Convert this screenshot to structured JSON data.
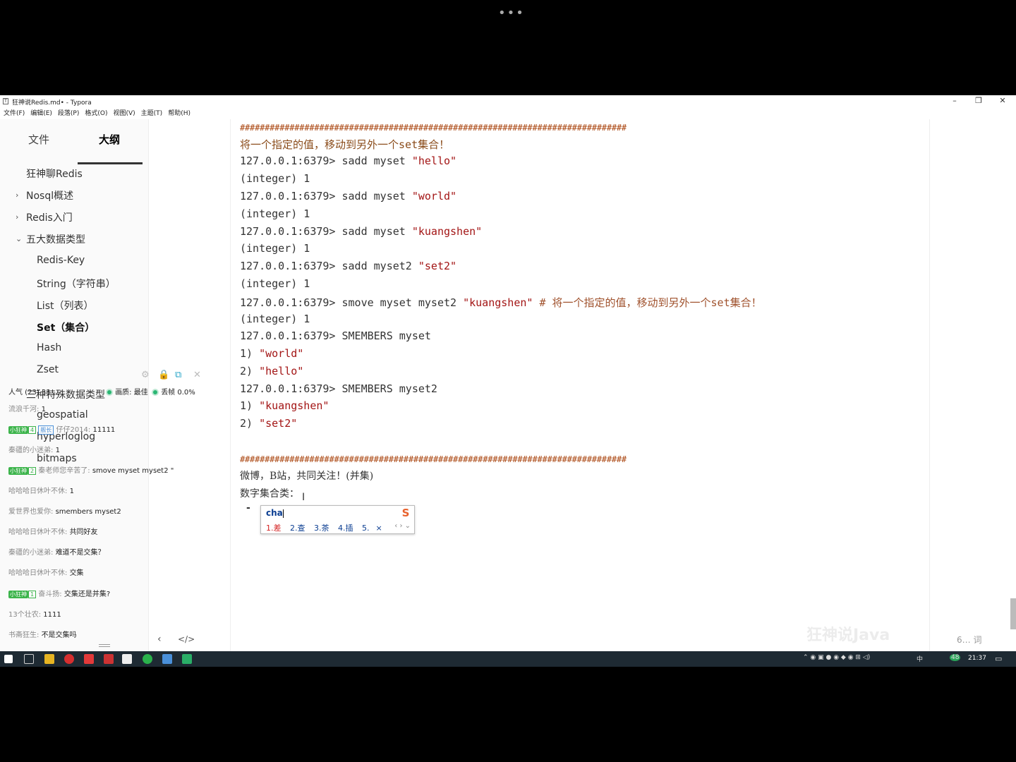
{
  "window": {
    "title": "狂神说Redis.md• - Typora",
    "menu": [
      "文件(F)",
      "编辑(E)",
      "段落(P)",
      "格式(O)",
      "视图(V)",
      "主题(T)",
      "帮助(H)"
    ]
  },
  "sidebar": {
    "tabs": [
      "文件",
      "大纲"
    ],
    "outline": [
      "狂神聊Redis",
      "Nosql概述",
      "Redis入门",
      "五大数据类型",
      "Redis-Key",
      "String（字符串）",
      "List（列表）",
      "Set（集合）",
      "Hash",
      "Zset",
      "三种特殊数据类型",
      "geospatial",
      "hyperloglog",
      "bitmaps"
    ]
  },
  "chat_overlay": {
    "header_left": "人气 (23) 33 ... ",
    "quality_label": "画质: 最佳",
    "drop_label": "丢帧 0.0%",
    "messages": [
      {
        "user": "流浪千河:",
        "text": "1"
      },
      {
        "badge": "小狂神",
        "level": "4",
        "role": "舰长",
        "user": "仔仔2014:",
        "text": "11111"
      },
      {
        "user": "秦疆的小迷弟:",
        "text": "1"
      },
      {
        "badge": "小狂神",
        "level": "2",
        "user": "秦老师您辛苦了:",
        "text": "smove myset myset2 \""
      },
      {
        "user": "哈哈哈日休叶不休:",
        "text": "1"
      },
      {
        "user": "爱世界也爱你:",
        "text": "smembers myset2"
      },
      {
        "user": "哈哈哈日休叶不休:",
        "text": "共同好友"
      },
      {
        "user": "秦疆的小迷弟:",
        "text": "难道不是交集？"
      },
      {
        "user": "哈哈哈日休叶不休:",
        "text": "交集"
      },
      {
        "badge": "小狂神",
        "level": "1",
        "user": "奋斗扬:",
        "text": "交集还是并集?"
      },
      {
        "user": "13个壮农:",
        "text": "1111"
      },
      {
        "user": "书斋狂生:",
        "text": "不是交集吗"
      }
    ]
  },
  "editor": {
    "separator": "##############################################################################",
    "heading_cn": "将一个指定的值，移动到另外一个set集合！",
    "lines": [
      {
        "prompt": "127.0.0.1:6379> ",
        "cmd": "sadd myset ",
        "str": "\"hello\""
      },
      {
        "out": "(integer) 1"
      },
      {
        "prompt": "127.0.0.1:6379> ",
        "cmd": "sadd myset ",
        "str": "\"world\""
      },
      {
        "out": "(integer) 1"
      },
      {
        "prompt": "127.0.0.1:6379> ",
        "cmd": "sadd myset ",
        "str": "\"kuangshen\""
      },
      {
        "out": "(integer) 1"
      },
      {
        "prompt": "127.0.0.1:6379> ",
        "cmd": "sadd myset2 ",
        "str": "\"set2\""
      },
      {
        "out": "(integer) 1"
      },
      {
        "prompt": "127.0.0.1:6379> ",
        "cmd": "smove myset myset2 ",
        "str": "\"kuangshen\"",
        "comment": " # 将一个指定的值，移动到另外一个set集合！"
      },
      {
        "out": "(integer) 1"
      },
      {
        "prompt": "127.0.0.1:6379> ",
        "cmd": "SMEMBERS myset"
      },
      {
        "out": "1) ",
        "str": "\"world\""
      },
      {
        "out": "2) ",
        "str": "\"hello\""
      },
      {
        "prompt": "127.0.0.1:6379> ",
        "cmd": "SMEMBERS myset2"
      },
      {
        "out": "1) ",
        "str": "\"kuangshen\""
      },
      {
        "out": "2) ",
        "str": "\"set2\""
      }
    ],
    "para1": "微博，B站，共同关注！(并集)",
    "para2": "数字集合类：",
    "bullet": "-"
  },
  "ime": {
    "input": "cha",
    "candidates": [
      "1.差",
      "2.查",
      "3.茶",
      "4.插",
      "5."
    ],
    "close": "×",
    "nav": "‹ › ⌄"
  },
  "status": {
    "word_count": "6… 词",
    "watermark": "狂神说Java",
    "clock": "21:37",
    "ime_lang": "中",
    "tray_badge": "48"
  }
}
